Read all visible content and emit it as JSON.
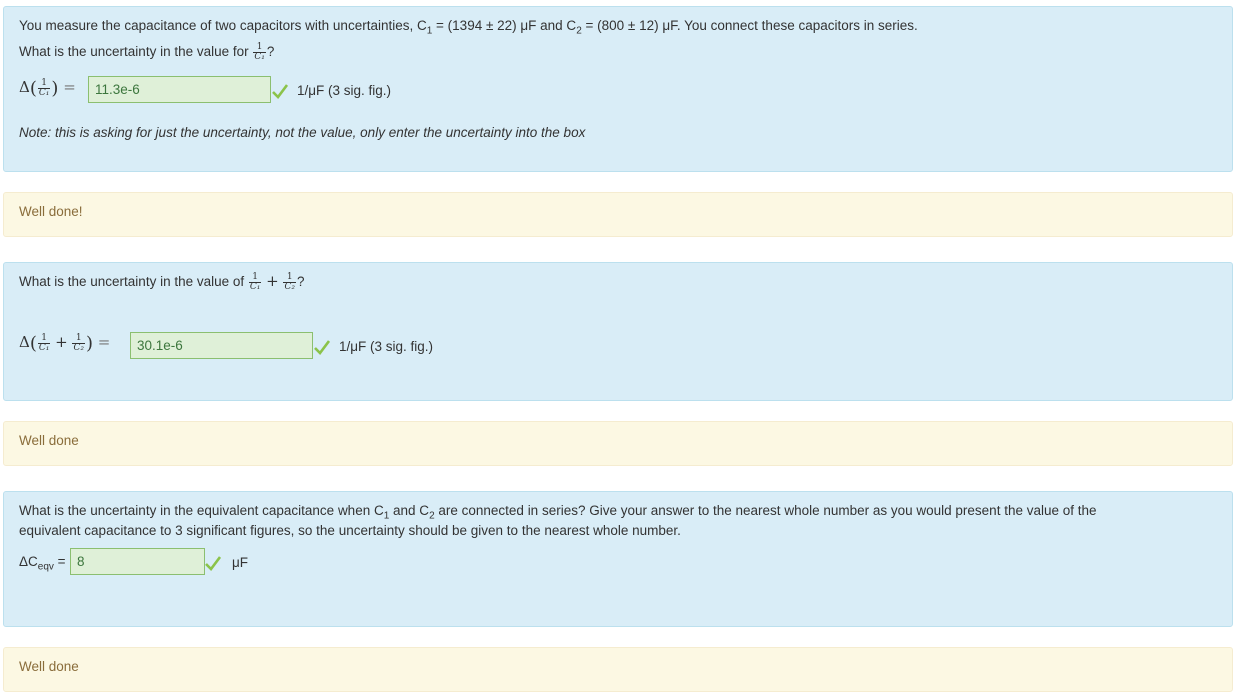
{
  "q1": {
    "question_part1": "You measure the capacitance of two capacitors with uncertainties, C",
    "question_sub1": "1",
    "question_part2": " = (1394 ± 22) μF and C",
    "question_sub2": "2",
    "question_part3": " = (800 ± 12) μF. You connect these capacitors in series.",
    "prompt": "What is the uncertainty in the value for ",
    "prompt_end": "?",
    "answer_value": "11.3e-6",
    "unit": "1/μF (3 sig. fig.)",
    "note": "Note: this is asking for just the uncertainty, not the value, only enter the uncertainty into the box"
  },
  "fb1": {
    "text": "Well done!"
  },
  "q2": {
    "prompt": "What is the uncertainty in the value of ",
    "prompt_end": "?",
    "answer_value": "30.1e-6",
    "unit": "1/μF (3 sig. fig.)"
  },
  "fb2": {
    "text": "Well done"
  },
  "q3": {
    "text_part1": "What is the uncertainty in the equivalent capacitance when C",
    "sub1": "1",
    "text_part2": " and C",
    "sub2": "2",
    "text_part3": " are connected in series? Give your answer to the nearest whole number as you would present the value of the",
    "text_line2": "equivalent capacitance to 3 significant figures, so the uncertainty should be given to the nearest whole number.",
    "label": "ΔC",
    "label_sub": "eqv",
    "label_eq": " =",
    "answer_value": "8",
    "unit": "μF"
  },
  "fb3": {
    "text": "Well done"
  },
  "math": {
    "delta": "Δ",
    "one": "1",
    "c1": "C₁",
    "c2": "C₂",
    "plus": "+",
    "equals": "="
  },
  "colors": {
    "question_bg": "#d9edf7",
    "feedback_bg": "#fcf8e3",
    "correct_bg": "#dff0d8",
    "check": "#8bc34a"
  },
  "icons": {
    "check": "check-icon"
  }
}
